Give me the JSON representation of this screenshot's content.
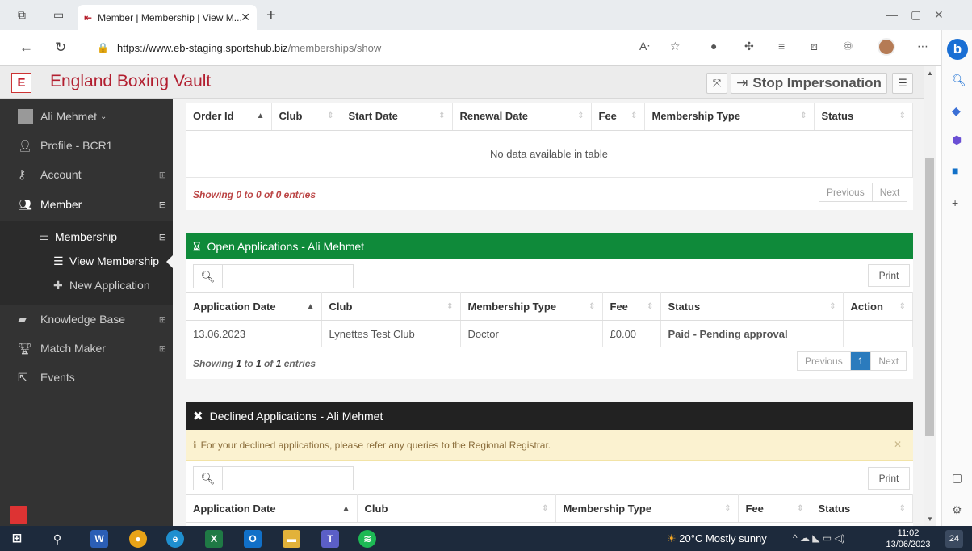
{
  "browser": {
    "tab_title": "Member | Membership | View M...",
    "new_tab": "+",
    "url_host": "https://www.eb-staging.sportshub.biz",
    "url_path": "/memberships/show"
  },
  "site": {
    "brand": "England Boxing Vault",
    "stop_impersonation": "Stop Impersonation"
  },
  "sidebar": {
    "user_name": "Ali Mehmet",
    "items": [
      {
        "label": "Profile - BCR1"
      },
      {
        "label": "Account"
      },
      {
        "label": "Member"
      },
      {
        "label": "Membership"
      },
      {
        "label": "View Membership"
      },
      {
        "label": "New Application"
      },
      {
        "label": "Knowledge Base"
      },
      {
        "label": "Match Maker"
      },
      {
        "label": "Events"
      }
    ]
  },
  "orders_table": {
    "columns": [
      "Order Id",
      "Club",
      "Start Date",
      "Renewal Date",
      "Fee",
      "Membership Type",
      "Status"
    ],
    "empty_text": "No data available in table",
    "info": "Showing 0 to 0 of 0 entries",
    "prev": "Previous",
    "next": "Next"
  },
  "open_applications": {
    "title": "Open Applications - Ali Mehmet",
    "print": "Print",
    "columns": [
      "Application Date",
      "Club",
      "Membership Type",
      "Fee",
      "Status",
      "Action"
    ],
    "rows": [
      {
        "date": "13.06.2023",
        "club": "Lynettes Test Club",
        "type": "Doctor",
        "fee": "£0.00",
        "status": "Paid - Pending approval",
        "action": ""
      }
    ],
    "info_prefix": "Showing ",
    "info_from": "1",
    "info_mid1": " to ",
    "info_to": "1",
    "info_mid2": " of ",
    "info_total": "1",
    "info_suffix": " entries",
    "prev": "Previous",
    "page": "1",
    "next": "Next"
  },
  "declined_applications": {
    "title": "Declined Applications - Ali Mehmet",
    "notice": "For your declined applications, please refer any queries to the Regional Registrar.",
    "print": "Print",
    "columns": [
      "Application Date",
      "Club",
      "Membership Type",
      "Fee",
      "Status"
    ]
  },
  "taskbar": {
    "weather": "20°C  Mostly sunny",
    "time": "11:02",
    "date": "13/06/2023",
    "notifications": "24"
  },
  "colors": {
    "brand": "#b21e2f",
    "open_header": "#0f8a3a",
    "declined_header": "#222222",
    "paid_status": "#f0a60a",
    "page_active": "#2b7bbd"
  }
}
